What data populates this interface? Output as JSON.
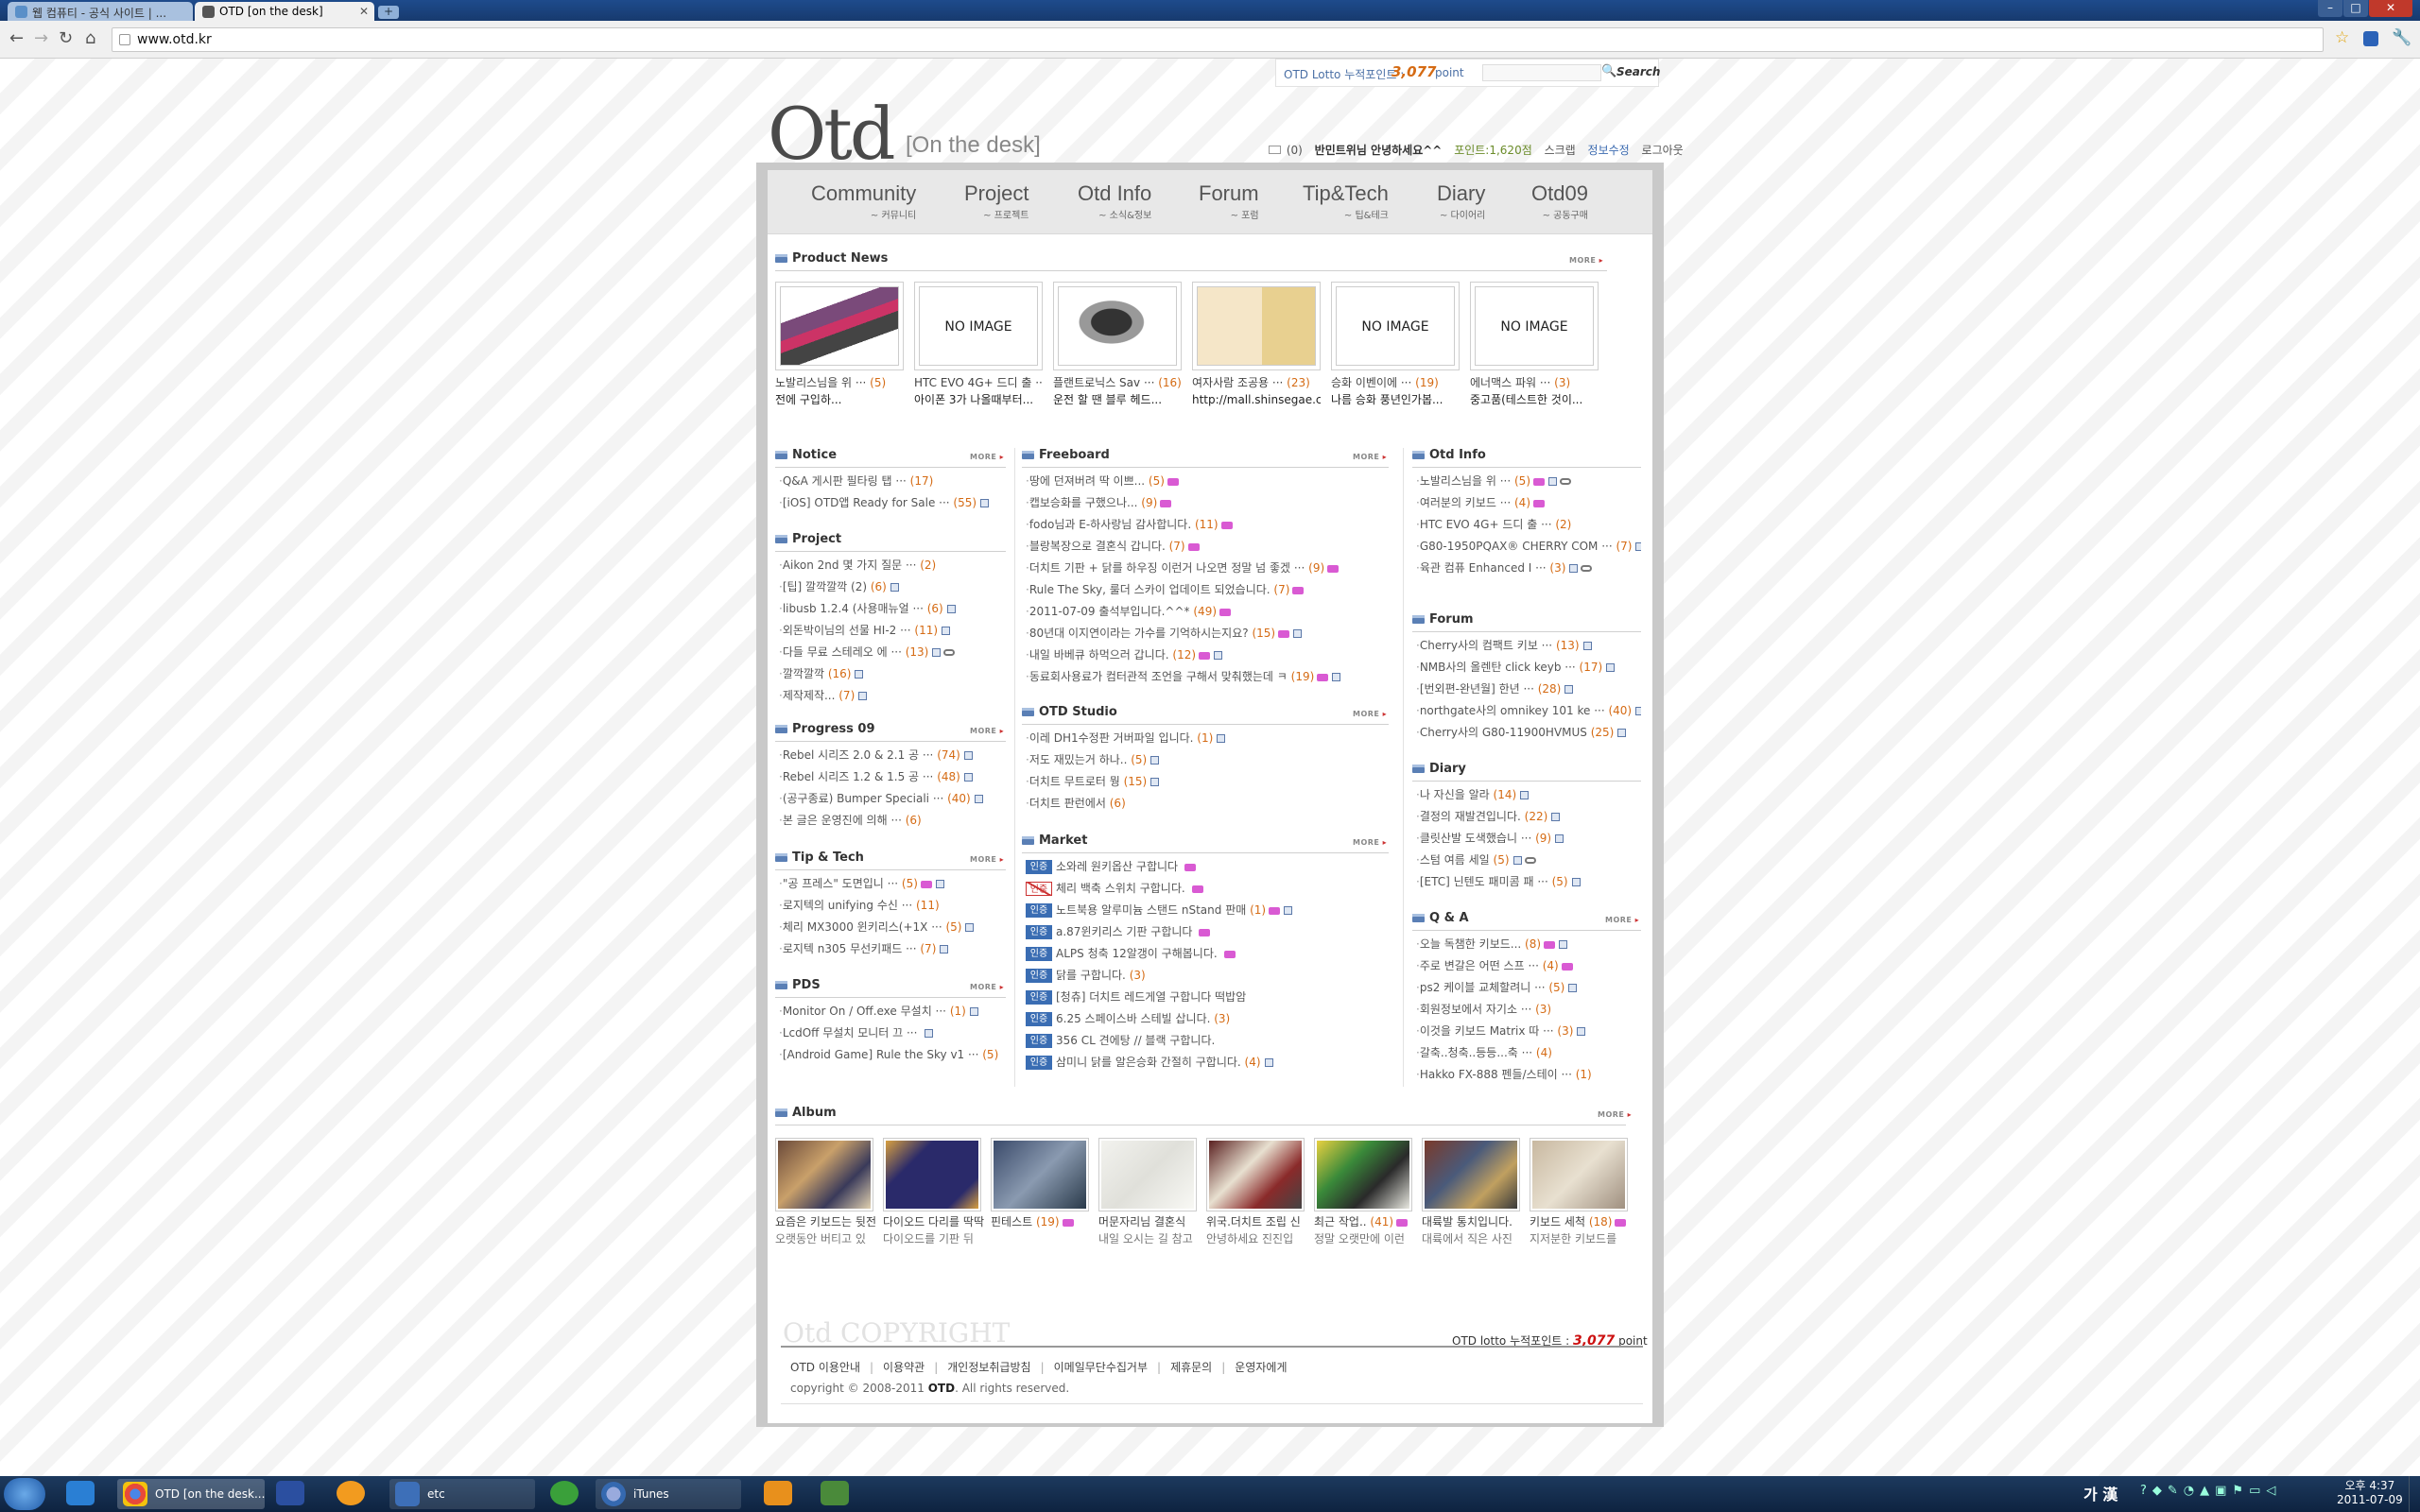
{
  "browser": {
    "tabs": [
      {
        "label": "웹 컴퓨티 - 공식 사이트 | ..."
      },
      {
        "label": "OTD [on the desk]"
      }
    ],
    "url": "www.otd.kr"
  },
  "topbar": {
    "lotto_label": "OTD Lotto 누적포인트 :",
    "lotto_points": "3,077",
    "lotto_unit": "point",
    "search_placeholder": "",
    "search_label": "Search"
  },
  "logo": {
    "main": "Otd",
    "sub": "[On the desk]"
  },
  "userbar": {
    "message": "(0)",
    "greeting": "반민트위님 안녕하세요^^",
    "points": "포인트:1,620점",
    "scrap": "스크랩",
    "edit": "정보수정",
    "logout": "로그아웃"
  },
  "nav": [
    {
      "en": "Community",
      "ko": "~ 커뮤니티"
    },
    {
      "en": "Project",
      "ko": "~ 프로젝트"
    },
    {
      "en": "Otd Info",
      "ko": "~ 소식&정보"
    },
    {
      "en": "Forum",
      "ko": "~ 포럼"
    },
    {
      "en": "Tip&Tech",
      "ko": "~ 팁&테크"
    },
    {
      "en": "Diary",
      "ko": "~ 다이어리"
    },
    {
      "en": "Otd09",
      "ko": "~ 공동구매"
    }
  ],
  "more_label": "MORE",
  "product_news": {
    "title": "Product News",
    "items": [
      {
        "img": "photo",
        "line1": "노발리스님을 위 ··· ",
        "count": "(5)",
        "line2": "전에 구입하..."
      },
      {
        "img": "NO IMAGE",
        "line1": "HTC EVO 4G+ 드디 출 ··· ",
        "count": "",
        "line2": "아이폰 3가 나올때부터..."
      },
      {
        "img": "photo",
        "line1": "플랜트로닉스 Sav ··· ",
        "count": "(16)",
        "line2": "운전 할 땐 블루 헤드..."
      },
      {
        "img": "photo",
        "line1": "여자사람 조공용 ··· ",
        "count": "(23)",
        "line2": "http://mall.shinsegae.co..."
      },
      {
        "img": "NO IMAGE",
        "line1": "승화 이벤이에 ··· ",
        "count": "(19)",
        "line2": "나름 승화 풍년인가봅..."
      },
      {
        "img": "NO IMAGE",
        "line1": "에너맥스 파워 ··· ",
        "count": "(3)",
        "line2": "중고품(테스트한 것이..."
      }
    ]
  },
  "left_sections": [
    {
      "title": "Notice",
      "more": true,
      "items": [
        {
          "text": "Q&A 게시판 필타링 탭 ··· ",
          "count": "(17)",
          "badges": []
        },
        {
          "text": "[iOS] OTD앱 Ready for Sale ··· ",
          "count": "(55)",
          "badges": [
            "doc"
          ]
        }
      ]
    },
    {
      "title": "Project",
      "more": false,
      "items": [
        {
          "text": "Aikon 2nd 몇 가지 질문 ··· ",
          "count": "(2)",
          "badges": []
        },
        {
          "text": "[팁] 깔깍깔깍 (2) ",
          "count": "(6)",
          "badges": [
            "doc"
          ]
        },
        {
          "text": "libusb 1.2.4 (사용매뉴얼 ··· ",
          "count": "(6)",
          "badges": [
            "doc"
          ]
        },
        {
          "text": "외돈박이님의 선물 HI-2 ··· ",
          "count": "(11)",
          "badges": [
            "doc"
          ]
        },
        {
          "text": "다들 무료 스테레오 에 ··· ",
          "count": "(13)",
          "badges": [
            "doc",
            "link"
          ]
        },
        {
          "text": "깔깍깔깍 ",
          "count": "(16)",
          "badges": [
            "doc"
          ]
        },
        {
          "text": "제작제작... ",
          "count": "(7)",
          "badges": [
            "doc"
          ]
        }
      ]
    },
    {
      "title": "Progress 09",
      "more": true,
      "items": [
        {
          "text": "Rebel 시리즈 2.0 & 2.1 공 ··· ",
          "count": "(74)",
          "badges": [
            "doc"
          ]
        },
        {
          "text": "Rebel 시리즈 1.2 & 1.5 공 ··· ",
          "count": "(48)",
          "badges": [
            "doc"
          ]
        },
        {
          "text": "(공구종료) Bumper Speciali ··· ",
          "count": "(40)",
          "badges": [
            "doc"
          ]
        },
        {
          "text": "본 글은 운영진에 의해 ··· ",
          "count": "(6)",
          "badges": []
        }
      ]
    },
    {
      "title": "Tip & Tech",
      "more": true,
      "items": [
        {
          "text": "\"공 프레스\" 도면입니 ··· ",
          "count": "(5)",
          "badges": [
            "new",
            "doc"
          ]
        },
        {
          "text": "로지텍의 unifying 수신 ··· ",
          "count": "(11)",
          "badges": []
        },
        {
          "text": "체리 MX3000 윈키리스(+1X ··· ",
          "count": "(5)",
          "badges": [
            "doc"
          ]
        },
        {
          "text": "로지텍 n305 무선키패드 ··· ",
          "count": "(7)",
          "badges": [
            "doc"
          ]
        }
      ]
    },
    {
      "title": "PDS",
      "more": true,
      "items": [
        {
          "text": "Monitor On / Off.exe 무설치 ··· ",
          "count": "(1)",
          "badges": [
            "doc"
          ]
        },
        {
          "text": "LcdOff 무설치 모니터 끄 ··· ",
          "count": "",
          "badges": [
            "doc"
          ]
        },
        {
          "text": "[Android Game] Rule the Sky v1 ··· ",
          "count": "(5)",
          "badges": []
        }
      ]
    }
  ],
  "mid_sections": [
    {
      "title": "Freeboard",
      "more": true,
      "items": [
        {
          "text": "땅에 던져버려 딱 이쁘... ",
          "count": "(5)",
          "badges": [
            "new"
          ]
        },
        {
          "text": "캡보승화를 구했으나... ",
          "count": "(9)",
          "badges": [
            "new"
          ]
        },
        {
          "text": "fodo님과 E-하사랑님 감사합니다. ",
          "count": "(11)",
          "badges": [
            "new"
          ]
        },
        {
          "text": "블랑복장으로 결혼식 갑니다. ",
          "count": "(7)",
          "badges": [
            "new"
          ]
        },
        {
          "text": "더치트 기판 + 닭를 하우징 이런거 나오면 정말 넘 좋겠 ··· ",
          "count": "(9)",
          "badges": [
            "new"
          ]
        },
        {
          "text": "Rule The Sky, 룰더 스카이 업데이트 되었습니다. ",
          "count": "(7)",
          "badges": [
            "new"
          ]
        },
        {
          "text": "2011-07-09 출석부입니다.^^* ",
          "count": "(49)",
          "badges": [
            "new"
          ]
        },
        {
          "text": "80년대 이지연이라는 가수를 기억하시는지요? ",
          "count": "(15)",
          "badges": [
            "new",
            "doc"
          ]
        },
        {
          "text": "내일 바베큐 하먹으러 갑니다. ",
          "count": "(12)",
          "badges": [
            "new",
            "doc"
          ]
        },
        {
          "text": "동료회사용료가 컴터관적 조언을 구해서 맞춰했는데 ㅋ ",
          "count": "(19)",
          "badges": [
            "new",
            "doc"
          ]
        }
      ]
    },
    {
      "title": "OTD Studio",
      "more": true,
      "items": [
        {
          "text": "이레 DH1수정판 거버파일 입니다. ",
          "count": "(1)",
          "badges": [
            "doc"
          ]
        },
        {
          "text": "저도 재밌는거 하나.. ",
          "count": "(5)",
          "badges": [
            "doc"
          ]
        },
        {
          "text": "더치트 무트로터 뭥 ",
          "count": "(15)",
          "badges": [
            "doc"
          ]
        },
        {
          "text": "더치트 판런에서 ",
          "count": "(6)",
          "badges": []
        }
      ]
    }
  ],
  "market": {
    "title": "Market",
    "tag": "인증",
    "items": [
      {
        "x": false,
        "text": "소와레 원키옵산 구합니다 ",
        "count": "",
        "badges": [
          "new"
        ]
      },
      {
        "x": true,
        "text": "체리 백축 스위치 구합니다. ",
        "count": "",
        "badges": [
          "new"
        ]
      },
      {
        "x": false,
        "text": "노트북용 알루미늄 스탠드 nStand 판매 ",
        "count": "(1)",
        "badges": [
          "new",
          "doc"
        ]
      },
      {
        "x": false,
        "text": "a.87윈키리스 기판 구합니다 ",
        "count": "",
        "badges": [
          "new"
        ]
      },
      {
        "x": false,
        "text": "ALPS 청축 12알갱이 구해봅니다. ",
        "count": "",
        "badges": [
          "new"
        ]
      },
      {
        "x": false,
        "text": "닭를 구합니다. ",
        "count": "(3)",
        "badges": []
      },
      {
        "x": false,
        "text": "[청츄] 더치트 레드게열 구합니다 떡밥암 ",
        "count": "",
        "badges": []
      },
      {
        "x": false,
        "text": "6.25 스페이스바 스테빌 삽니다. ",
        "count": "(3)",
        "badges": []
      },
      {
        "x": false,
        "text": "356 CL 견에탕 // 블랙 구합니다. ",
        "count": "",
        "badges": []
      },
      {
        "x": false,
        "text": "삼미니 닭를 알은승화 간절히 구합니다. ",
        "count": "(4)",
        "badges": [
          "doc"
        ]
      }
    ]
  },
  "right_sections": [
    {
      "title": "Otd Info",
      "more": false,
      "items": [
        {
          "text": "노발리스님을 위 ··· ",
          "count": "(5)",
          "badges": [
            "new",
            "doc",
            "link"
          ]
        },
        {
          "text": "여러분의 키보드 ··· ",
          "count": "(4)",
          "badges": [
            "new"
          ]
        },
        {
          "text": "HTC EVO 4G+ 드디 출 ··· ",
          "count": "(2)",
          "badges": []
        },
        {
          "text": "G80-1950PQAX® CHERRY COM ··· ",
          "count": "(7)",
          "badges": [
            "doc",
            "link"
          ]
        },
        {
          "text": "육관 컴퓨 Enhanced I ··· ",
          "count": "(3)",
          "badges": [
            "doc",
            "link"
          ]
        }
      ]
    },
    {
      "title": "Forum",
      "more": false,
      "items": [
        {
          "text": "Cherry사의 컴팩트 키보 ··· ",
          "count": "(13)",
          "badges": [
            "doc"
          ]
        },
        {
          "text": "NMB사의 올렌탄 click keyb ··· ",
          "count": "(17)",
          "badges": [
            "doc"
          ]
        },
        {
          "text": "[번외편-완년월] 한년 ··· ",
          "count": "(28)",
          "badges": [
            "doc"
          ]
        },
        {
          "text": "northgate사의 omnikey 101 ke ··· ",
          "count": "(40)",
          "badges": [
            "doc"
          ]
        },
        {
          "text": "Cherry사의 G80-11900HVMUS ",
          "count": "(25)",
          "badges": [
            "doc"
          ]
        }
      ]
    },
    {
      "title": "Diary",
      "more": false,
      "items": [
        {
          "text": "나 자신을 알라 ",
          "count": "(14)",
          "badges": [
            "doc"
          ]
        },
        {
          "text": "결정의 재발견입니다. ",
          "count": "(22)",
          "badges": [
            "doc"
          ]
        },
        {
          "text": "클릿산발 도색했습니 ··· ",
          "count": "(9)",
          "badges": [
            "doc"
          ]
        },
        {
          "text": "스텀 여름 세일 ",
          "count": "(5)",
          "badges": [
            "doc",
            "link"
          ]
        },
        {
          "text": "[ETC] 닌텐도 패미콤 패 ··· ",
          "count": "(5)",
          "badges": [
            "doc"
          ]
        }
      ]
    },
    {
      "title": "Q & A",
      "more": true,
      "items": [
        {
          "text": "오늘 독챔한 키보드... ",
          "count": "(8)",
          "badges": [
            "new",
            "doc"
          ]
        },
        {
          "text": "주로 변갈은 어떤 스프 ··· ",
          "count": "(4)",
          "badges": [
            "new"
          ]
        },
        {
          "text": "ps2 케이블 교체할려니 ··· ",
          "count": "(5)",
          "badges": [
            "doc"
          ]
        },
        {
          "text": "회원정보에서 자기소 ··· ",
          "count": "(3)",
          "badges": []
        },
        {
          "text": "이것을 키보드 Matrix 따 ··· ",
          "count": "(3)",
          "badges": [
            "doc"
          ]
        },
        {
          "text": "갈축..청축..등등...축 ··· ",
          "count": "(4)",
          "badges": []
        },
        {
          "text": "Hakko FX-888 펜들/스테이 ··· ",
          "count": "(1)",
          "badges": []
        }
      ]
    }
  ],
  "album": {
    "title": "Album",
    "items": [
      {
        "line1": "요즘은 키보드는 뒷전 ",
        "count": "",
        "line2": "오랫동안 버티고 있"
      },
      {
        "line1": "다이오드 다리를 딱딱 ",
        "count": "",
        "line2": "다이오드를 기판 뒤"
      },
      {
        "line1": "핀테스트 ",
        "count": "(19)",
        "line2": ""
      },
      {
        "line1": "머문자리님 결혼식 ",
        "count": "",
        "line2": "내일 오시는 길 참고"
      },
      {
        "line1": "위국.더치트 조립 신",
        "count": "",
        "line2": "안녕하세요 진진입"
      },
      {
        "line1": "최근 작업.. ",
        "count": "(41)",
        "line2": "정말 오랫만에 이런"
      },
      {
        "line1": "대륙발 통치입니다. ",
        "count": "",
        "line2": "대륙에서 직은 사진"
      },
      {
        "line1": "키보드 세척 ",
        "count": "(18)",
        "line2": "지저분한 키보드를"
      }
    ]
  },
  "footer": {
    "logo": "Otd COPYRIGHT",
    "lotto_label": "OTD lotto 누적포인트 :",
    "lotto_points": "3,077",
    "lotto_unit": "point",
    "links": [
      "OTD 이용안내",
      "이용약관",
      "개인정보취급방침",
      "이메일무단수집거부",
      "제휴문의",
      "운영자에게"
    ],
    "copyright_prefix": "copyright © 2008-2011",
    "copyright_brand": "OTD",
    "copyright_suffix": ". All rights reserved."
  },
  "taskbar": {
    "items": [
      "OTD [on the desk...",
      "etc",
      "iTunes"
    ],
    "ime": "가 漢",
    "time": "오후 4:37",
    "date": "2011-07-09"
  },
  "colors": {
    "accent_orange": "#d56b14",
    "points_red": "#cc1111",
    "nav_bg": "#e8e8e8",
    "title_blue": "#1e4b8c"
  }
}
